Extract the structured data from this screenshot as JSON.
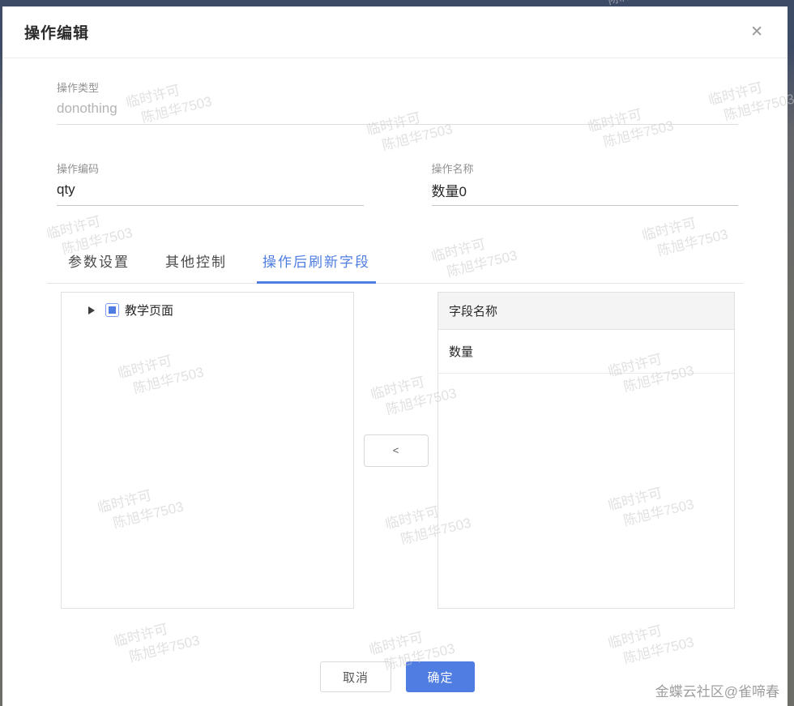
{
  "dialog": {
    "title": "操作编辑",
    "close_icon": "✕"
  },
  "fields": {
    "type": {
      "label": "操作类型",
      "value": "donothing"
    },
    "code": {
      "label": "操作编码",
      "value": "qty"
    },
    "name": {
      "label": "操作名称",
      "value": "数量0"
    }
  },
  "tabs": [
    {
      "label": "参数设置"
    },
    {
      "label": "其他控制"
    },
    {
      "label": "操作后刷新字段"
    }
  ],
  "tree": {
    "root": {
      "label": "教学页面",
      "checkbox_state": "indeterminate"
    }
  },
  "transfer": {
    "move_left_label": "<"
  },
  "table": {
    "header": "字段名称",
    "rows": [
      "数量"
    ]
  },
  "footer": {
    "cancel_label": "取消",
    "confirm_label": "确定"
  },
  "watermark": {
    "line1": "临时许可",
    "line2": "陈旭华7503"
  },
  "credit": "金蝶云社区@雀啼春",
  "colors": {
    "accent": "#4f7de2",
    "table_header_bg": "#f4f4f4",
    "backdrop_top": "#3e4b66"
  }
}
